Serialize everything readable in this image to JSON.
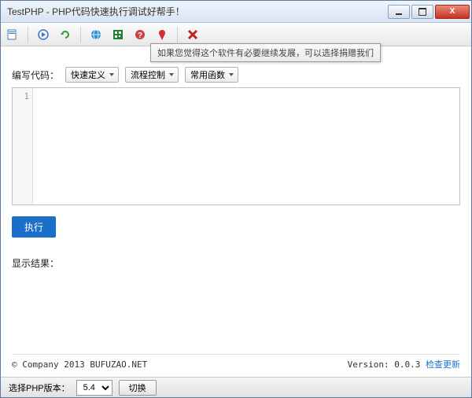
{
  "window": {
    "title": "TestPHP - PHP代码快速执行调试好帮手！"
  },
  "toolbar": {
    "icons": [
      "new-icon",
      "play-icon",
      "refresh-icon",
      "globe-icon",
      "qr-icon",
      "help-icon",
      "donate-icon",
      "close-icon"
    ],
    "tooltip": "如果您觉得这个软件有必要继续发展，可以选择捐赠我们"
  },
  "editor_section": {
    "label": "编写代码：",
    "dropdowns": [
      {
        "label": "快速定义",
        "name": "quick-define"
      },
      {
        "label": "流程控制",
        "name": "flow-control"
      },
      {
        "label": "常用函数",
        "name": "common-funcs"
      }
    ],
    "line_number": "1"
  },
  "exec_button": "执行",
  "result_label": "显示结果：",
  "footer": {
    "copyright": "© Company 2013 BUFUZAO.NET",
    "version_label": "Version: 0.0.3",
    "update_link": "检查更新"
  },
  "statusbar": {
    "label": "选择PHP版本：",
    "selected": "5.4",
    "switch": "切换"
  }
}
